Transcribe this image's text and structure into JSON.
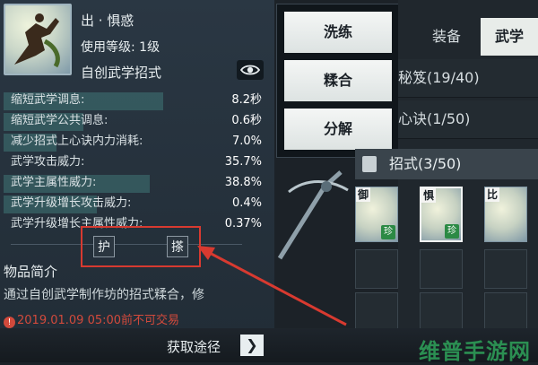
{
  "item": {
    "name": "出 · 惧惑",
    "level_req": "使用等级: 1级",
    "type": "自创武学招式"
  },
  "stats": [
    {
      "label": "缩短武学调息:",
      "value": "8.2秒",
      "fill": 0.6
    },
    {
      "label": "缩短武学公共调息:",
      "value": "0.6秒",
      "fill": 0.3
    },
    {
      "label": "减少招式上心诀内力消耗:",
      "value": "7.0%",
      "fill": 0.2
    },
    {
      "label": "武学攻击威力:",
      "value": "35.7%",
      "fill": 0.0
    },
    {
      "label": "武学主属性威力:",
      "value": "38.8%",
      "fill": 0.55
    },
    {
      "label": "武学升级增长攻击威力:",
      "value": "0.4%",
      "fill": 0.35
    },
    {
      "label": "武学升级增长主属性威力:",
      "value": "0.37%",
      "fill": 0.0
    }
  ],
  "skill_slots": [
    "护",
    "搽"
  ],
  "info": {
    "section_title": "物品简介",
    "description": "通过自创武学制作坊的招式糅合，修",
    "warning": "2019.01.09 05:00前不可交易"
  },
  "menu": {
    "refine": "洗练",
    "combine": "糅合",
    "decompose": "分解"
  },
  "tabs": {
    "equipment": "装备",
    "martial": "武学"
  },
  "right_list": {
    "secret_manual": "秘笈(19/40)",
    "mind_formula": "心诀(1/50)",
    "moves": "招式(3/50)"
  },
  "skill_cards": [
    {
      "char": "御",
      "badge": "珍"
    },
    {
      "char": "惧",
      "badge": "珍"
    },
    {
      "char": "比",
      "badge": ""
    }
  ],
  "acquire": {
    "label": "获取途径",
    "arrow": "❯"
  },
  "watermark": "维普手游网",
  "colors": {
    "highlight_border": "#d83a30",
    "warning_text": "#d24a3c",
    "rarity_badge": "#2c8a45"
  }
}
